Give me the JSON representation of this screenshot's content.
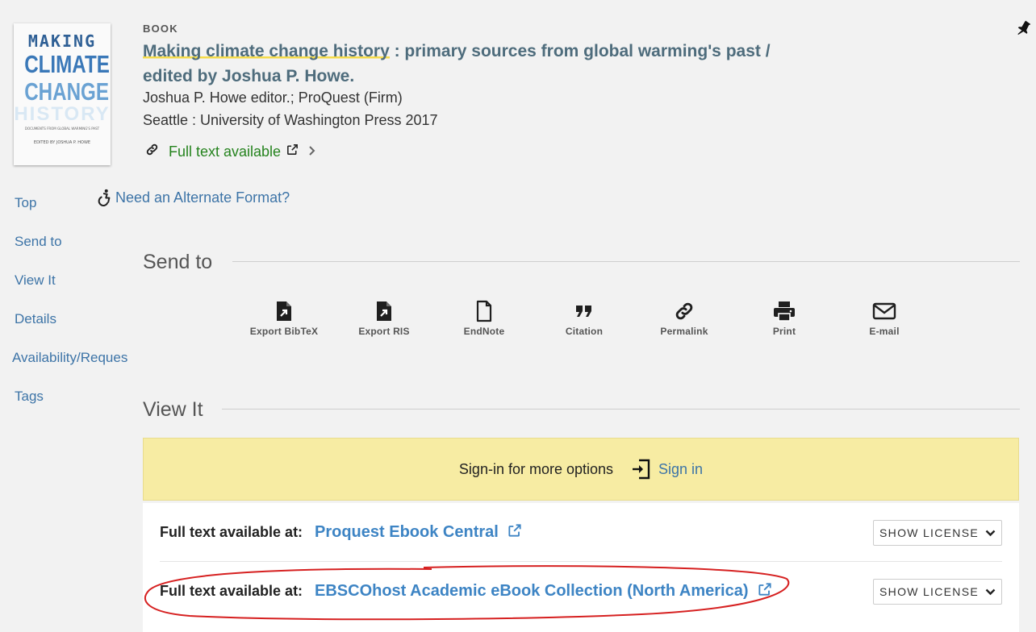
{
  "cover": {
    "line1": "MAKING",
    "line2": "CLIMATE",
    "line3": "CHANGE",
    "line4": "HISTORY",
    "line5": "DOCUMENTS FROM GLOBAL WARMING'S PAST",
    "line6": "EDITED BY JOSHUA P. HOWE"
  },
  "record": {
    "type": "BOOK",
    "title_main": "Making climate change history",
    "title_rest": " : primary sources from global warming's past /",
    "title_line2": "edited by Joshua P. Howe.",
    "author": "Joshua P. Howe editor.; ProQuest (Firm)",
    "publication": "Seattle : University of Washington Press 2017",
    "availability": "Full text available",
    "alt_format": "Need an Alternate Format?"
  },
  "nav": {
    "items": [
      "Top",
      "Send to",
      "View It",
      "Details",
      "Availability/Reques",
      "Tags"
    ]
  },
  "sendto": {
    "title": "Send to",
    "actions": [
      {
        "label": "Export BibTeX",
        "icon": "file-export-icon"
      },
      {
        "label": "Export RIS",
        "icon": "file-export-icon"
      },
      {
        "label": "EndNote",
        "icon": "file-icon"
      },
      {
        "label": "Citation",
        "icon": "quote-icon"
      },
      {
        "label": "Permalink",
        "icon": "link-icon"
      },
      {
        "label": "Print",
        "icon": "printer-icon"
      },
      {
        "label": "E-mail",
        "icon": "mail-icon"
      }
    ]
  },
  "viewit": {
    "title": "View It",
    "signin_message": "Sign-in for more options",
    "signin_label": "Sign in",
    "rows": [
      {
        "label": "Full text available at:",
        "link": "Proquest Ebook Central",
        "license": "SHOW LICENSE"
      },
      {
        "label": "Full text available at:",
        "link": "EBSCOhost Academic eBook Collection (North America)",
        "license": "SHOW LICENSE"
      }
    ]
  },
  "colors": {
    "link": "#3d74a7",
    "title": "#4e6c7c",
    "available": "#25831e",
    "highlight": "#f5dc4a",
    "signin_bg": "#f7eca3",
    "annotation": "#d62020"
  }
}
